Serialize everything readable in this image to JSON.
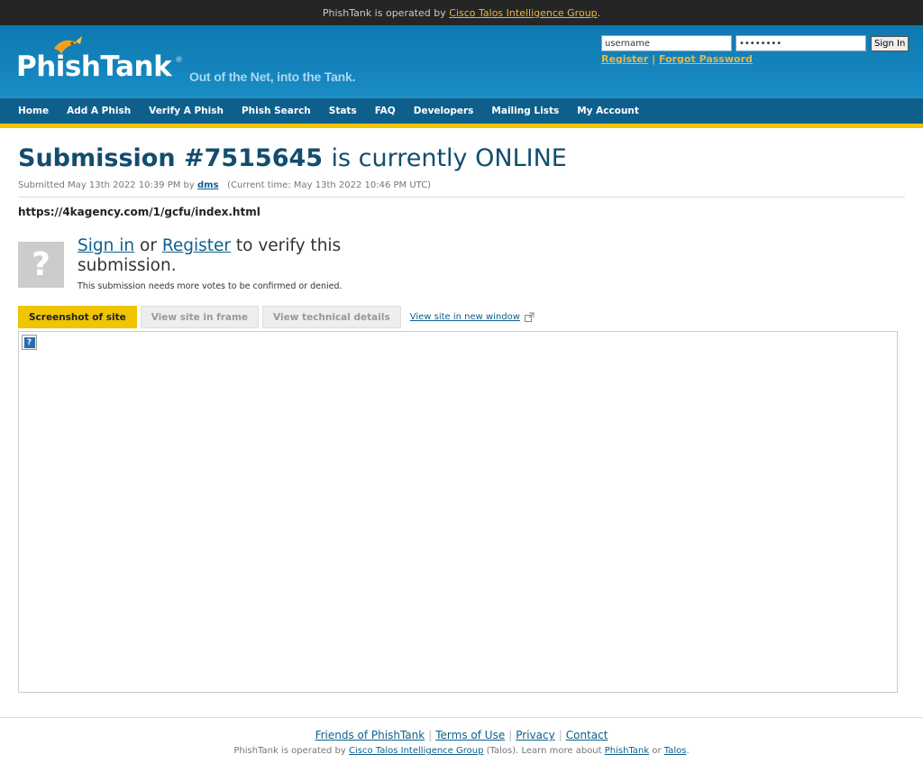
{
  "topbar": {
    "prefix": "PhishTank is operated by",
    "link": "Cisco Talos Intelligence Group",
    "suffix": "."
  },
  "brand": {
    "name": "PhishTank",
    "registered": "®",
    "tagline": "Out of the Net, into the Tank.",
    "accent_color": "#f1c400",
    "header_color": "#0e78b0"
  },
  "login": {
    "username_value": "username",
    "password_value": "password",
    "sign_in_label": "Sign In",
    "register_label": "Register",
    "separator": "|",
    "forgot_label": "Forgot Password"
  },
  "nav": {
    "items": [
      {
        "label": "Home"
      },
      {
        "label": "Add A Phish"
      },
      {
        "label": "Verify A Phish"
      },
      {
        "label": "Phish Search"
      },
      {
        "label": "Stats"
      },
      {
        "label": "FAQ"
      },
      {
        "label": "Developers"
      },
      {
        "label": "Mailing Lists"
      },
      {
        "label": "My Account"
      }
    ]
  },
  "submission": {
    "title_number": "Submission #7515645",
    "title_status": "is currently ONLINE",
    "submitted_prefix": "Submitted May 13th 2022 10:39 PM by",
    "submitted_by": "dms",
    "current_time": "(Current time: May 13th 2022 10:46 PM UTC)",
    "url": "https://4kagency.com/1/gcfu/index.html"
  },
  "verify": {
    "placeholder_glyph": "?",
    "sign_in_label": "Sign in",
    "or_text": "or",
    "register_label": "Register",
    "rest_text": "to verify this submission.",
    "note": "This submission needs more votes to be confirmed or denied."
  },
  "tabs": {
    "items": [
      {
        "label": "Screenshot of site",
        "active": true
      },
      {
        "label": "View site in frame",
        "active": false
      },
      {
        "label": "View technical details",
        "active": false
      }
    ],
    "new_window_label": "View site in new window"
  },
  "preview": {
    "broken_image_glyph": "?"
  },
  "footer": {
    "links": [
      {
        "label": "Friends of PhishTank"
      },
      {
        "label": "Terms of Use"
      },
      {
        "label": "Privacy"
      },
      {
        "label": "Contact"
      }
    ],
    "note_prefix": "PhishTank is operated by",
    "note_link_talos_group": "Cisco Talos Intelligence Group",
    "note_middle": "(Talos). Learn more about",
    "note_link_phishtank": "PhishTank",
    "note_or": "or",
    "note_link_talos": "Talos",
    "note_end": "."
  }
}
